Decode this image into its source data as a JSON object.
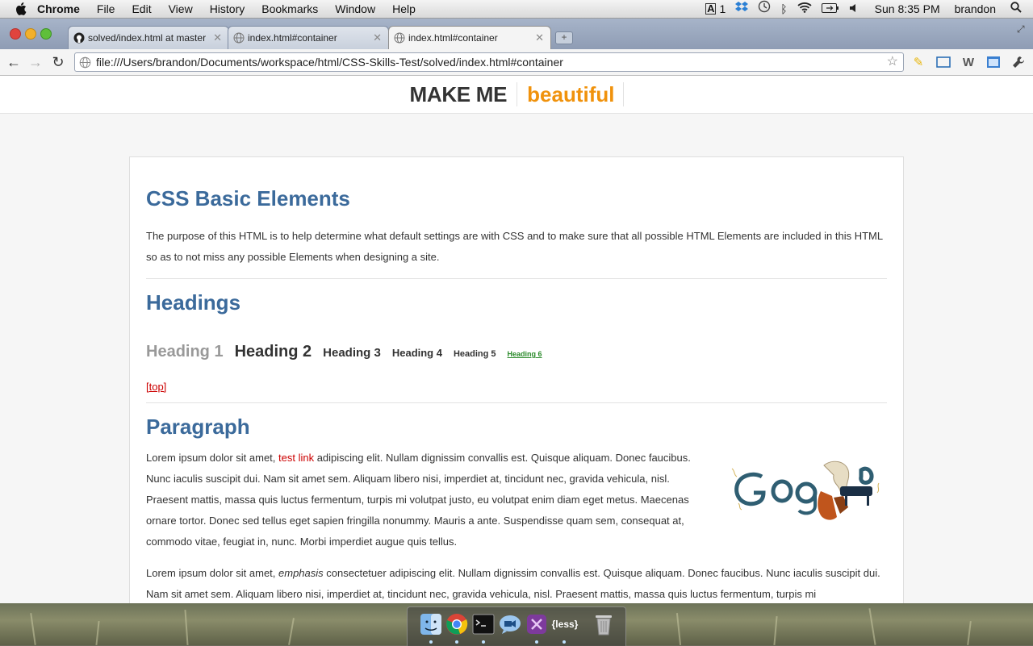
{
  "menubar": {
    "app": "Chrome",
    "items": [
      "File",
      "Edit",
      "View",
      "History",
      "Bookmarks",
      "Window",
      "Help"
    ],
    "status_number": "1",
    "clock": "Sun 8:35 PM",
    "user": "brandon"
  },
  "tabs": [
    {
      "title": "solved/index.html at master"
    },
    {
      "title": "index.html#container"
    },
    {
      "title": "index.html#container"
    }
  ],
  "toolbar": {
    "url": "file:///Users/brandon/Documents/workspace/html/CSS-Skills-Test/solved/index.html#container"
  },
  "site": {
    "logo_main": "MAKE ME",
    "logo_sub": "beautiful"
  },
  "content": {
    "title": "CSS Basic Elements",
    "intro": "The purpose of this HTML is to help determine what default settings are with CSS and to make sure that all possible HTML Elements are included in this HTML so as to not miss any possible Elements when designing a site.",
    "headings_title": "Headings",
    "headings": [
      "Heading 1",
      "Heading 2",
      "Heading 3",
      "Heading 4",
      "Heading 5",
      "Heading 6"
    ],
    "top_link": "[top]",
    "paragraph_title": "Paragraph",
    "p1_before": "Lorem ipsum dolor sit amet, ",
    "p1_link": "test link",
    "p1_after": " adipiscing elit. Nullam dignissim convallis est. Quisque aliquam. Donec faucibus. Nunc iaculis suscipit dui. Nam sit amet sem. Aliquam libero nisi, imperdiet at, tincidunt nec, gravida vehicula, nisl. Praesent mattis, massa quis luctus fermentum, turpis mi volutpat justo, eu volutpat enim diam eget metus. Maecenas ornare tortor. Donec sed tellus eget sapien fringilla nonummy. Mauris a ante. Suspendisse quam sem, consequat at, commodo vitae, feugiat in, nunc. Morbi imperdiet augue quis tellus.",
    "p2_before": "Lorem ipsum dolor sit amet, ",
    "p2_em": "emphasis",
    "p2_after": " consectetuer adipiscing elit. Nullam dignissim convallis est. Quisque aliquam. Donec faucibus. Nunc iaculis suscipit dui. Nam sit amet sem. Aliquam libero nisi, imperdiet at, tincidunt nec, gravida vehicula, nisl. Praesent mattis, massa quis luctus fermentum, turpis mi"
  },
  "dock": {
    "less_label": "{less}"
  },
  "colors": {
    "heading_blue": "#3b6a9b",
    "accent_orange": "#f0920c",
    "link_red": "#cc0000"
  }
}
